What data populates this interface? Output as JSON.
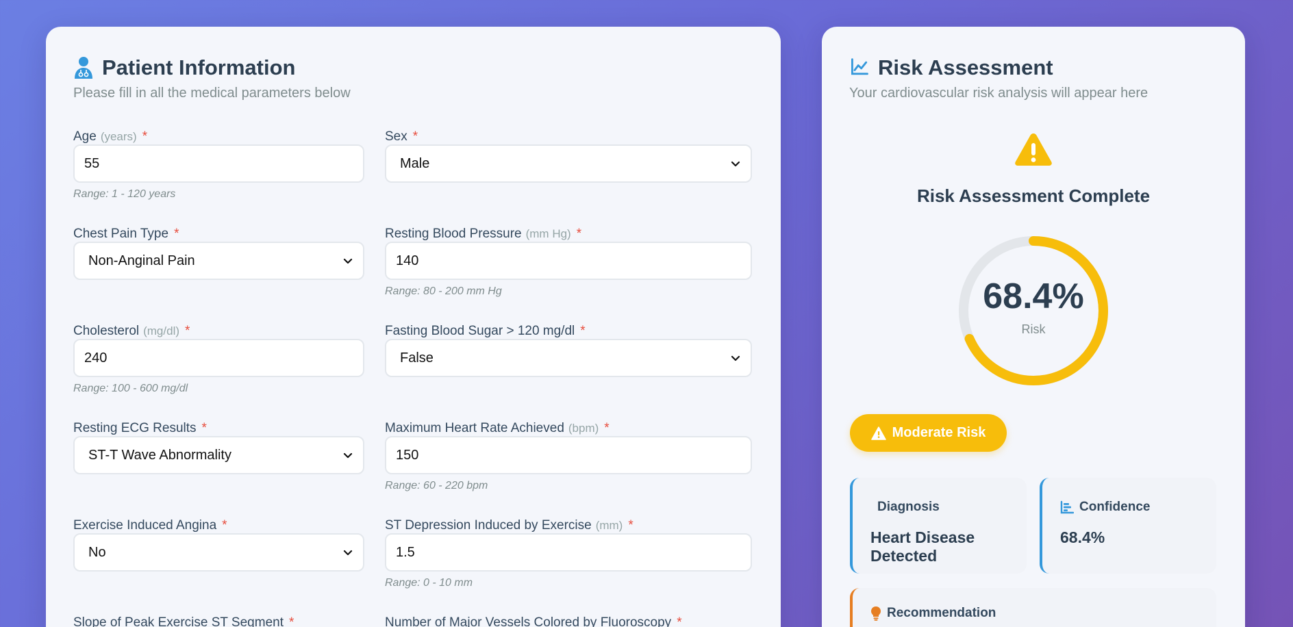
{
  "patient_card": {
    "title": "Patient Information",
    "subtitle": "Please fill in all the medical parameters below"
  },
  "fields": {
    "age": {
      "label": "Age",
      "unit": "(years)",
      "req": "*",
      "value": "55",
      "hint": "Range: 1 - 120 years"
    },
    "sex": {
      "label": "Sex",
      "req": "*",
      "value": "Male"
    },
    "chest_pain": {
      "label": "Chest Pain Type",
      "req": "*",
      "value": "Non-Anginal Pain"
    },
    "resting_bp": {
      "label": "Resting Blood Pressure",
      "unit": "(mm Hg)",
      "req": "*",
      "value": "140",
      "hint": "Range: 80 - 200 mm Hg"
    },
    "cholesterol": {
      "label": "Cholesterol",
      "unit": "(mg/dl)",
      "req": "*",
      "value": "240",
      "hint": "Range: 100 - 600 mg/dl"
    },
    "fbs": {
      "label": "Fasting Blood Sugar > 120 mg/dl",
      "req": "*",
      "value": "False"
    },
    "ecg": {
      "label": "Resting ECG Results",
      "req": "*",
      "value": "ST-T Wave Abnormality"
    },
    "max_hr": {
      "label": "Maximum Heart Rate Achieved",
      "unit": "(bpm)",
      "req": "*",
      "value": "150",
      "hint": "Range: 60 - 220 bpm"
    },
    "angina": {
      "label": "Exercise Induced Angina",
      "req": "*",
      "value": "No"
    },
    "st_depression": {
      "label": "ST Depression Induced by Exercise",
      "unit": "(mm)",
      "req": "*",
      "value": "1.5",
      "hint": "Range: 0 - 10 mm"
    },
    "slope": {
      "label": "Slope of Peak Exercise ST Segment",
      "req": "*"
    },
    "vessels": {
      "label": "Number of Major Vessels Colored by Fluoroscopy",
      "req": "*"
    }
  },
  "risk_card": {
    "title": "Risk Assessment",
    "subtitle": "Your cardiovascular risk analysis will appear here",
    "complete_title": "Risk Assessment Complete",
    "risk_value": "68.4%",
    "risk_fraction": 0.684,
    "risk_caption": "Risk",
    "risk_level": "Moderate Risk",
    "diagnosis_label": "Diagnosis",
    "diagnosis_value": "Heart Disease Detected",
    "confidence_label": "Confidence",
    "confidence_value": "68.4%",
    "recommendation_label": "Recommendation"
  },
  "colors": {
    "accent_yellow": "#f7bd0b",
    "accent_blue": "#3498db",
    "accent_orange": "#e67e22",
    "required_red": "#e74c3c",
    "title_dark": "#2c3e50"
  },
  "icons": {
    "patient": "doctor-icon",
    "risk": "chart-line-icon",
    "warning": "warning-icon",
    "confidence": "bar-chart-icon",
    "recommendation": "lightbulb-icon",
    "select": "chevron-down-icon"
  }
}
